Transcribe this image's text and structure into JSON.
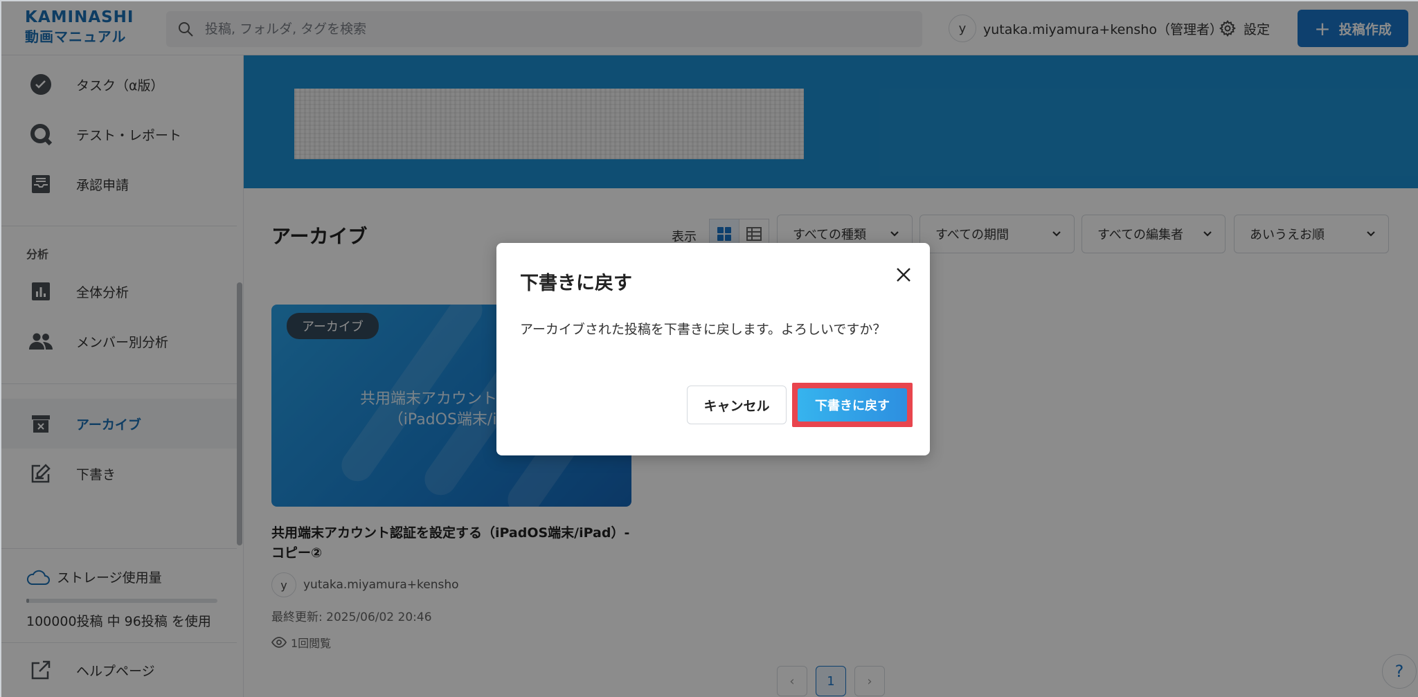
{
  "header": {
    "logo_top": "KAMINASHI",
    "logo_bottom": "動画マニュアル",
    "search_placeholder": "投稿, フォルダ, タグを検索",
    "user_initial": "y",
    "user_name": "yutaka.miyamura+kensho（管理者）",
    "settings_label": "設定",
    "create_label": "投稿作成"
  },
  "sidebar": {
    "items_top": [
      {
        "label": "タスク（α版）",
        "icon": "task-check-icon"
      },
      {
        "label": "テスト・レポート",
        "icon": "quiz-icon"
      },
      {
        "label": "承認申請",
        "icon": "inbox-icon"
      }
    ],
    "analysis_section": "分析",
    "items_analysis": [
      {
        "label": "全体分析",
        "icon": "bar-chart-icon"
      },
      {
        "label": "メンバー別分析",
        "icon": "members-icon"
      }
    ],
    "items_bottom": [
      {
        "label": "アーカイブ",
        "icon": "archive-icon",
        "active": true
      },
      {
        "label": "下書き",
        "icon": "draft-edit-icon"
      }
    ],
    "storage_label": "ストレージ使用量",
    "storage_text": "100000投稿 中 96投稿 を使用",
    "storage_used_fraction": 0.00096,
    "help_label": "ヘルプページ"
  },
  "main": {
    "title": "アーカイブ",
    "view_label": "表示",
    "filters": [
      "すべての種類",
      "すべての期間",
      "すべての編集者",
      "あいうえお順"
    ],
    "card": {
      "badge": "アーカイブ",
      "thumb_line1": "共用端末アカウント認証を",
      "thumb_line2": "（iPadOS端末/iPa",
      "title": "共用端末アカウント認証を設定する（iPadOS端末/iPad）-コピー②",
      "author_initial": "y",
      "author": "yutaka.miyamura+kensho",
      "updated": "最終更新: 2025/06/02 20:46",
      "views": "1回閲覧"
    },
    "pagination": {
      "prev": "‹",
      "current": "1",
      "next": "›"
    },
    "help_fab": "?"
  },
  "modal": {
    "title": "下書きに戻す",
    "message": "アーカイブされた投稿を下書きに戻します。よろしいですか？",
    "cancel_label": "キャンセル",
    "confirm_label": "下書きに戻す"
  },
  "colors": {
    "brand": "#1a6fb5",
    "banner": "#1d8fd2",
    "confirm_highlight": "#e8454e"
  }
}
